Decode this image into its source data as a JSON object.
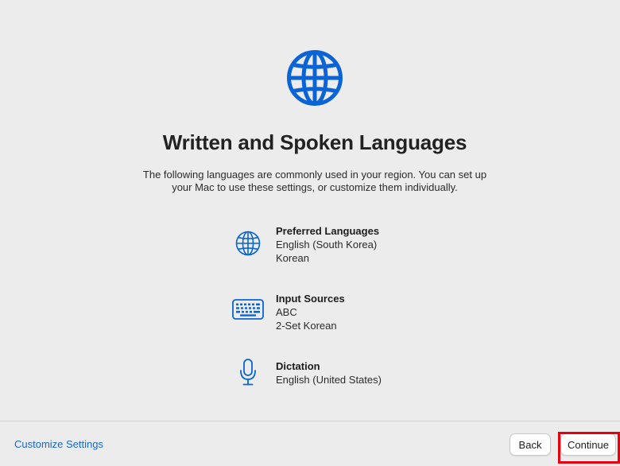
{
  "header": {
    "icon": "globe-icon",
    "title": "Written and Spoken Languages",
    "subtitle": "The following languages are commonly used in your region. You can set up your Mac to use these settings, or customize them individually."
  },
  "items": [
    {
      "icon": "globe-icon",
      "heading": "Preferred Languages",
      "lines": [
        "English (South Korea)",
        "Korean"
      ]
    },
    {
      "icon": "keyboard-icon",
      "heading": "Input Sources",
      "lines": [
        "ABC",
        "2-Set Korean"
      ]
    },
    {
      "icon": "microphone-icon",
      "heading": "Dictation",
      "lines": [
        "English (United States)"
      ]
    }
  ],
  "footer": {
    "customize_label": "Customize Settings",
    "back_label": "Back",
    "continue_label": "Continue"
  },
  "colors": {
    "accent": "#0a64d6",
    "link": "#1a67d6",
    "background": "#ececec",
    "highlight": "#e8000d"
  }
}
